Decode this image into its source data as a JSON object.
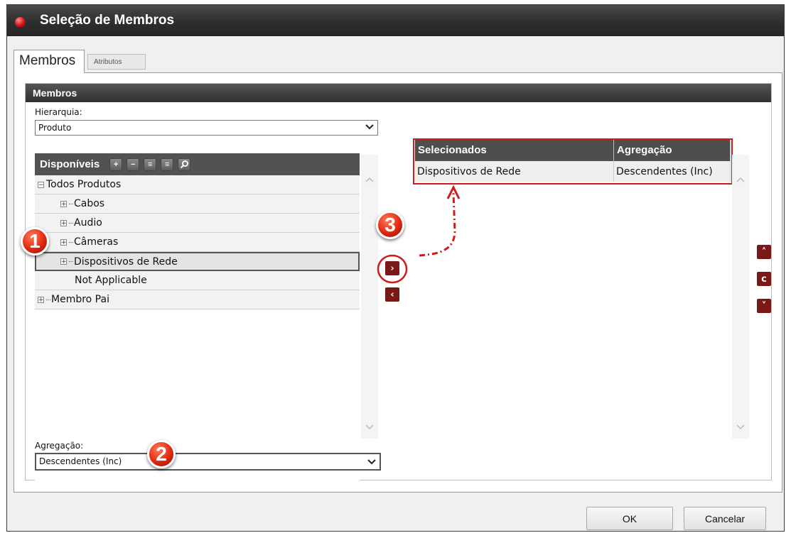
{
  "window": {
    "title": "Seleção de Membros"
  },
  "tabs": [
    {
      "label": "Membros",
      "active": true
    },
    {
      "label": "Atributos",
      "active": false
    }
  ],
  "panel": {
    "header": "Membros",
    "hierarchy_label": "Hierarquia:",
    "hierarchy_value": "Produto",
    "available": {
      "header": "Disponíveis",
      "toolbar_icons": [
        "expand-all-icon",
        "collapse-all-icon",
        "add-level-icon",
        "remove-level-icon",
        "search-icon"
      ],
      "items": [
        {
          "label": "Todos Produtos",
          "toggle": "−"
        },
        {
          "label": "Cabos",
          "toggle": "+"
        },
        {
          "label": "Audio",
          "toggle": "+"
        },
        {
          "label": "Câmeras",
          "toggle": "+"
        },
        {
          "label": "Dispositivos de Rede",
          "toggle": "+",
          "selected": true
        },
        {
          "label": "Not Applicable",
          "toggle": ""
        },
        {
          "label": "Membro Pai",
          "toggle": "+"
        }
      ]
    },
    "aggregation_label": "Agregação:",
    "aggregation_value": "Descendentes (Inc)",
    "selected": {
      "columns": [
        "Selecionados",
        "Agregação"
      ],
      "rows": [
        {
          "member": "Dispositivos de Rede",
          "aggregation": "Descendentes (Inc)"
        }
      ]
    },
    "move_buttons": {
      "add": "›",
      "remove": "‹"
    },
    "order_buttons": {
      "up": "˄",
      "reset": "c",
      "down": "˅"
    }
  },
  "annotations": [
    "1",
    "2",
    "3"
  ],
  "footer": {
    "ok": "OK",
    "cancel": "Cancelar"
  },
  "colors": {
    "accent": "#7a1818",
    "highlight": "#d11a1a",
    "header": "#4e4e4e"
  }
}
